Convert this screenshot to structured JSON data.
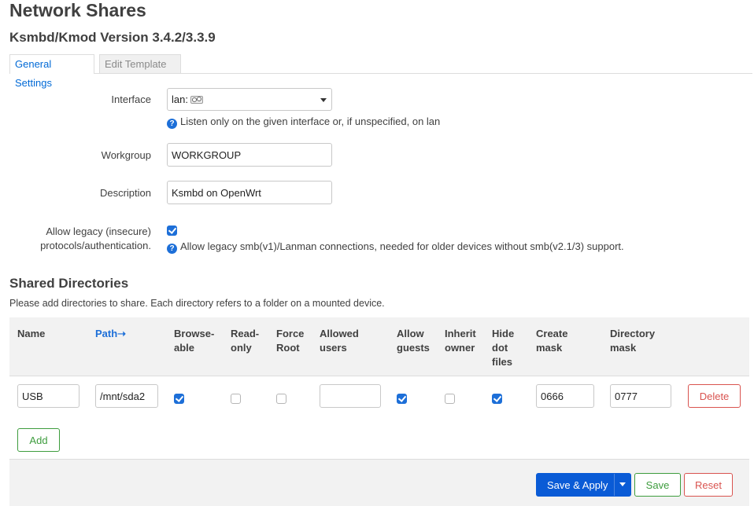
{
  "page": {
    "title": "Network Shares",
    "subtitle": "Ksmbd/Kmod Version 3.4.2/3.3.9"
  },
  "tabs": [
    {
      "label": "General Settings",
      "active": true
    },
    {
      "label": "Edit Template",
      "active": false
    }
  ],
  "general": {
    "interface": {
      "label": "Interface",
      "value": "lan:",
      "icon": "network-interface-icon",
      "help": "Listen only on the given interface or, if unspecified, on lan"
    },
    "workgroup": {
      "label": "Workgroup",
      "value": "WORKGROUP"
    },
    "description": {
      "label": "Description",
      "value": "Ksmbd on OpenWrt"
    },
    "legacy": {
      "label_line1": "Allow legacy (insecure)",
      "label_line2": "protocols/authentication.",
      "checked": true,
      "help": "Allow legacy smb(v1)/Lanman connections, needed for older devices without smb(v2.1/3) support."
    }
  },
  "shares": {
    "title": "Shared Directories",
    "description": "Please add directories to share. Each directory refers to a folder on a mounted device.",
    "columns": {
      "name": [
        "Name"
      ],
      "path": [
        "Path➝"
      ],
      "browseable": [
        "Browse-",
        "able"
      ],
      "readonly": [
        "Read-",
        "only"
      ],
      "forceroot": [
        "Force",
        "Root"
      ],
      "allowed_users": [
        "Allowed",
        "users"
      ],
      "allow_guests": [
        "Allow",
        "guests"
      ],
      "inherit_owner": [
        "Inherit",
        "owner"
      ],
      "hide_dot": [
        "Hide",
        "dot",
        "files"
      ],
      "create_mask": [
        "Create",
        "mask"
      ],
      "dir_mask": [
        "Directory",
        "mask"
      ]
    },
    "rows": [
      {
        "name": "USB",
        "path": "/mnt/sda2",
        "browseable": true,
        "readonly": false,
        "forceroot": false,
        "allowed_users": "",
        "allow_guests": true,
        "inherit_owner": false,
        "hide_dot": true,
        "create_mask": "0666",
        "dir_mask": "0777",
        "delete_label": "Delete"
      }
    ],
    "add_label": "Add"
  },
  "footer": {
    "save_apply_label": "Save & Apply",
    "save_label": "Save",
    "reset_label": "Reset"
  },
  "colors": {
    "accent": "#1d6fd8",
    "primary_button": "#0a5bd6",
    "positive": "#3d9c3d",
    "negative": "#d9534f"
  }
}
